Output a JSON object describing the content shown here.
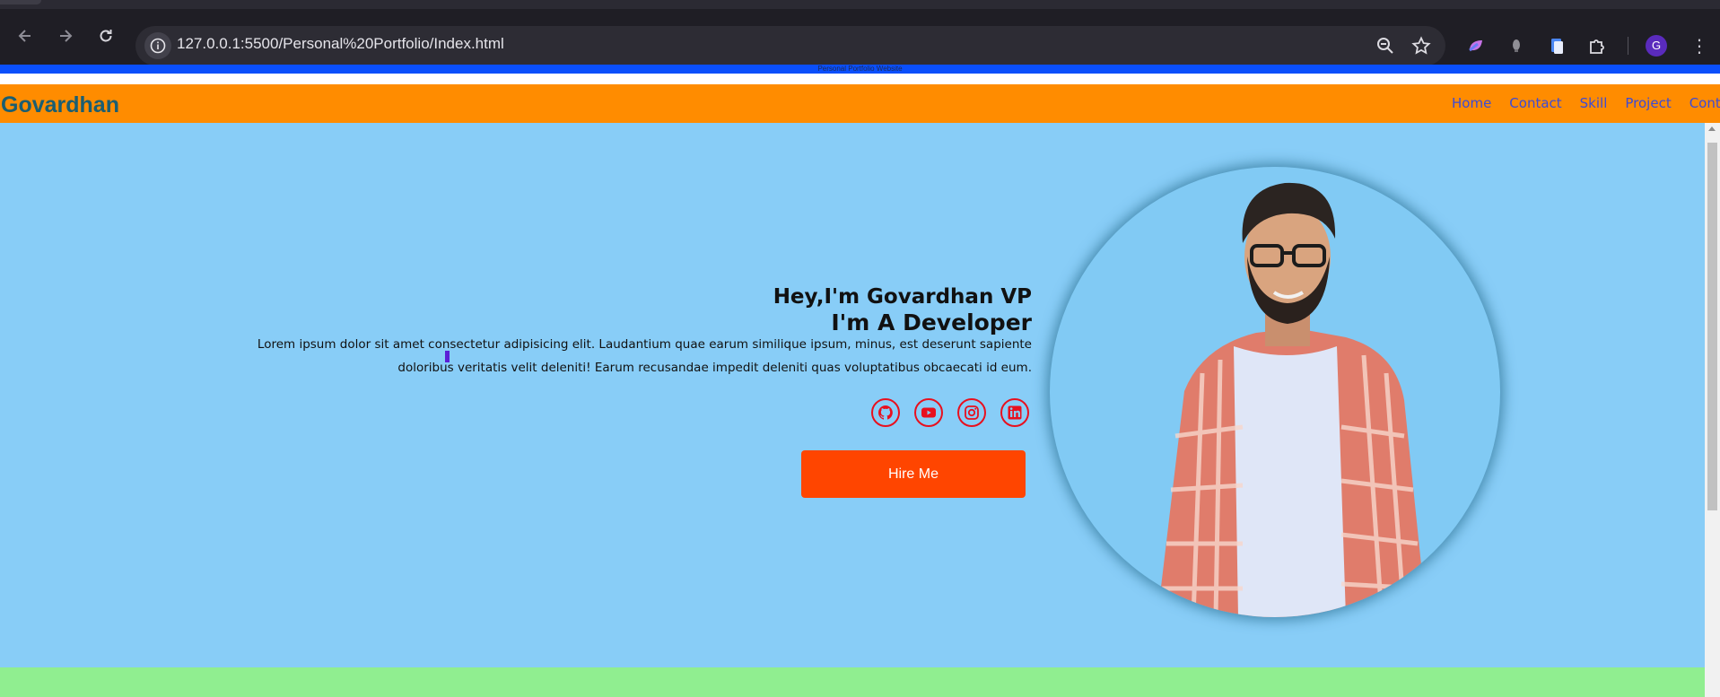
{
  "browser": {
    "url": "127.0.0.1:5500/Personal%20Portfolio/Index.html",
    "profile_initial": "G",
    "icons": [
      "back-icon",
      "forward-icon",
      "reload-icon",
      "site-info-icon",
      "zoom-icon",
      "star-icon",
      "extension-icon",
      "puzzle-icon"
    ]
  },
  "page": {
    "tooltip": "Personal Portfolio Website",
    "brand": "Govardhan",
    "menu": [
      "Home",
      "Contact",
      "Skill",
      "Project",
      "Contact"
    ],
    "hero": {
      "greeting": "Hey,I'm Govardhan VP",
      "role": "I'm A Developer",
      "description": "Lorem ipsum dolor sit amet consectetur adipisicing elit. Laudantium quae earum similique ipsum, minus, est deserunt sapiente doloribus veritatis velit deleniti! Earum recusandae impedit deleniti quas voluptatibus obcaecati id eum.",
      "socials": [
        "github-icon",
        "youtube-icon",
        "instagram-icon",
        "linkedin-icon"
      ],
      "cta": "Hire Me"
    }
  },
  "colors": {
    "nav_bg": "#ff8c00",
    "hero_bg": "#88cdf7",
    "footer_bg": "#90ee90",
    "button_bg": "#ff4500",
    "accent_blue": "#0a4ffb"
  }
}
